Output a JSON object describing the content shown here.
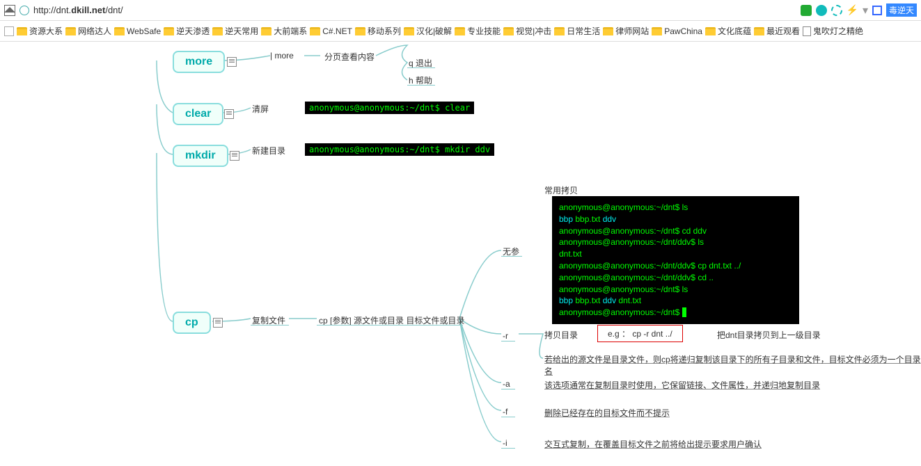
{
  "browser": {
    "url_prefix": "http://dnt.",
    "url_bold": "dkill.net",
    "url_suffix": "/dnt/",
    "blue_tag": "毒逆天"
  },
  "bookmarks": [
    "资源大系",
    "网络达人",
    "WebSafe",
    "逆天渗透",
    "逆天常用",
    "大前端系",
    "C#.NET",
    "移动系列",
    "汉化|破解",
    "专业技能",
    "视觉|冲击",
    "日常生活",
    "律师网站",
    "PawChina",
    "文化底蕴",
    "最近观看",
    "鬼吹灯之精绝"
  ],
  "nodes": {
    "more": {
      "label": "more",
      "col1": "| more",
      "col2": "分页查看内容",
      "sub1": "q 退出",
      "sub2": "h 帮助"
    },
    "clear": {
      "label": "clear",
      "col1": "清屏",
      "term": "anonymous@anonymous:~/dnt$ clear "
    },
    "mkdir": {
      "label": "mkdir",
      "col1": "新建目录",
      "term": "anonymous@anonymous:~/dnt$ mkdir ddv"
    },
    "cp": {
      "label": "cp",
      "col1": "复制文件",
      "usage": "cp  [参数]  源文件或目录  目标文件或目录",
      "sub_noarg": {
        "flag": "无参",
        "title": "常用拷贝"
      },
      "sub_r": {
        "flag": "-r",
        "title": "拷贝目录",
        "eg": "e.g ： cp -r dnt ../",
        "right": "把dnt目录拷贝到上一级目录",
        "desc": "若给出的源文件是目录文件，则cp将递归复制该目录下的所有子目录和文件，目标文件必须为一个目录名"
      },
      "sub_a": {
        "flag": "-a",
        "desc": "该选项通常在复制目录时使用，它保留链接、文件属性，并递归地复制目录"
      },
      "sub_f": {
        "flag": "-f",
        "desc": "删除已经存在的目标文件而不提示"
      },
      "sub_i": {
        "flag": "-i",
        "desc": "交互式复制，在覆盖目标文件之前将给出提示要求用户确认"
      }
    }
  },
  "terminal": {
    "l1_prompt": "anonymous@anonymous:~/dnt$ ",
    "l1_cmd": "ls",
    "l2_a": "bbp",
    "l2_b": "  bbp.txt  ",
    "l2_c": "ddv",
    "l3_prompt": "anonymous@anonymous:~/dnt$ ",
    "l3_cmd": "cd ddv",
    "l4_prompt": "anonymous@anonymous:~/dnt/ddv$ ",
    "l4_cmd": "ls",
    "l5": "dnt.txt",
    "l6_prompt": "anonymous@anonymous:~/dnt/ddv$ ",
    "l6_cmd": "cp dnt.txt ../",
    "l7_prompt": "anonymous@anonymous:~/dnt/ddv$ ",
    "l7_cmd": "cd ..",
    "l8_prompt": "anonymous@anonymous:~/dnt$ ",
    "l8_cmd": "ls",
    "l9_a": "bbp",
    "l9_b": "  bbp.txt  ",
    "l9_c": "ddv",
    "l9_d": "  dnt.txt",
    "l10_prompt": "anonymous@anonymous:~/dnt$ "
  }
}
